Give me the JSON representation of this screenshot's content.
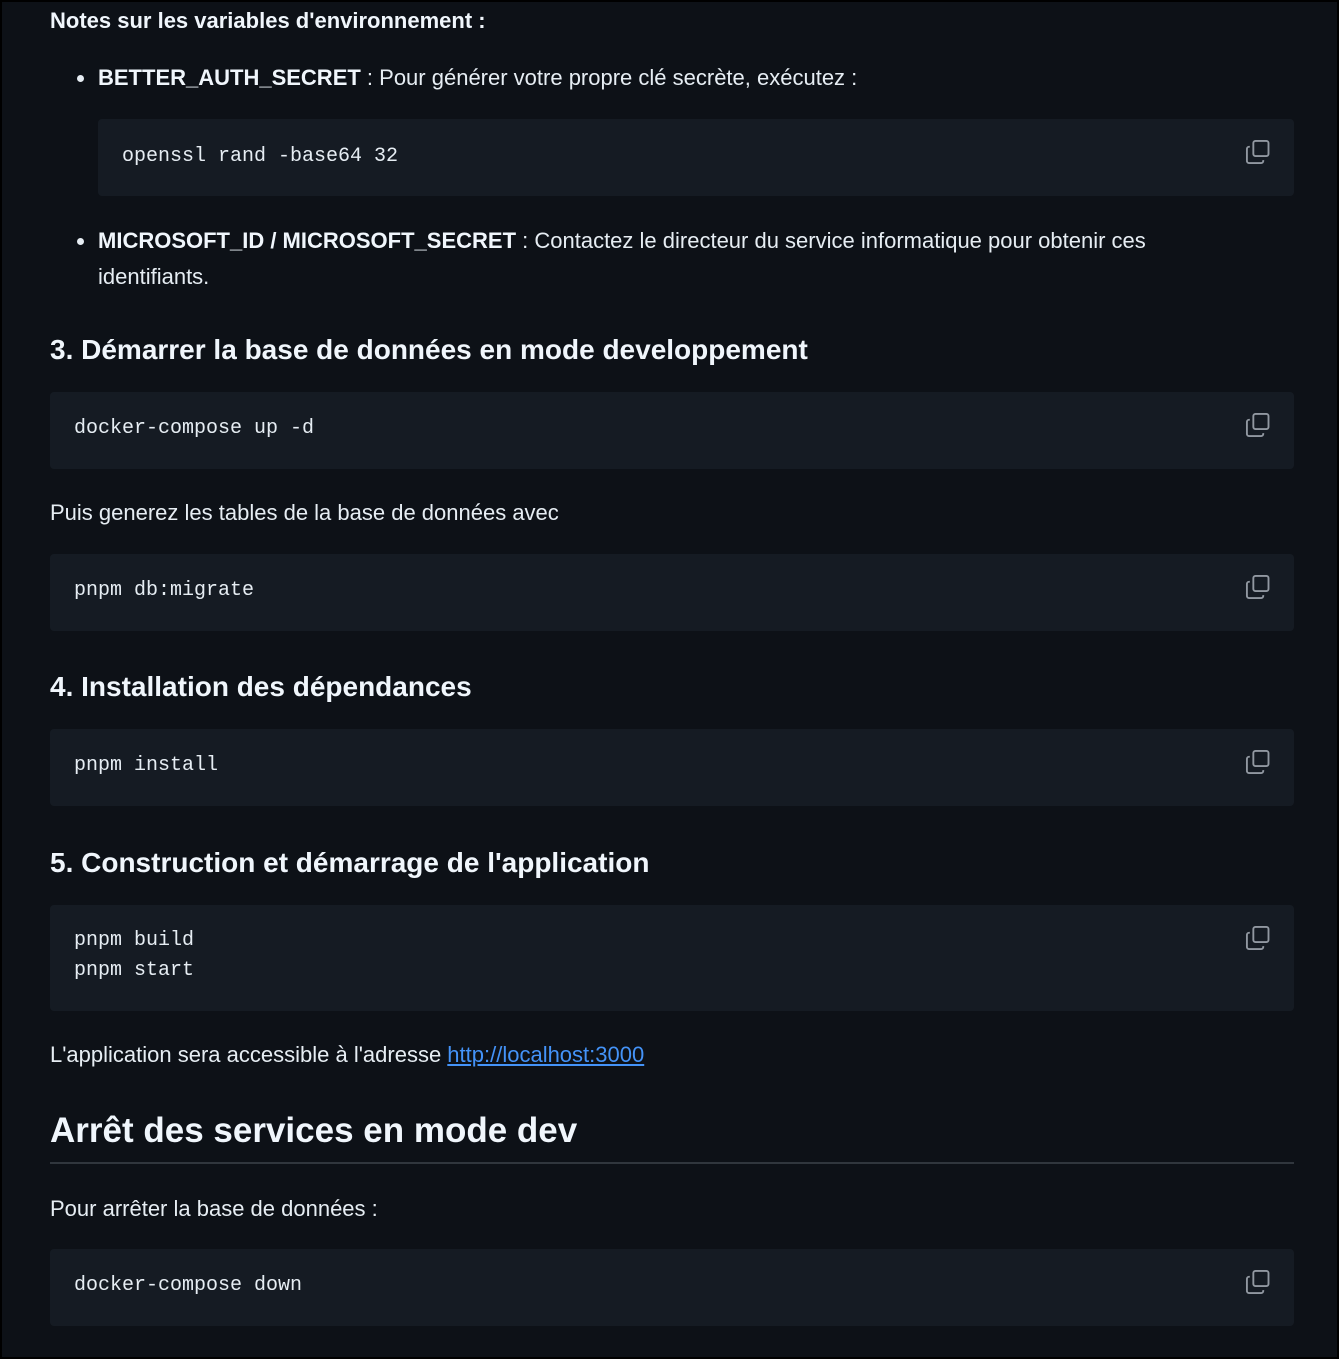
{
  "notes": {
    "title": "Notes sur les variables d'environnement :",
    "items": [
      {
        "key": "BETTER_AUTH_SECRET",
        "text": " : Pour générer votre propre clé secrète, exécutez :"
      },
      {
        "key": "MICROSOFT_ID / MICROSOFT_SECRET",
        "text": " : Contactez le directeur du service informatique pour obtenir ces identifiants."
      }
    ],
    "code": "openssl rand -base64 32"
  },
  "section3": {
    "heading": "3. Démarrer la base de données en mode developpement",
    "code1": "docker-compose up -d",
    "paragraph": "Puis generez les tables de la base de données avec",
    "code2": "pnpm db:migrate"
  },
  "section4": {
    "heading": "4. Installation des dépendances",
    "code": "pnpm install"
  },
  "section5": {
    "heading": "5. Construction et démarrage de l'application",
    "code_line1": "pnpm build",
    "code_line2": "pnpm start",
    "paragraph_prefix": "L'application sera accessible à l'adresse ",
    "link": "http://localhost:3000"
  },
  "stop": {
    "heading": "Arrêt des services en mode dev",
    "paragraph": "Pour arrêter la base de données :",
    "code": "docker-compose down"
  },
  "colors": {
    "background": "#0d1117",
    "code_background": "#151b23",
    "link": "#4493f8",
    "text": "#e6edf3"
  },
  "icons": {
    "copy": "copy-icon"
  }
}
